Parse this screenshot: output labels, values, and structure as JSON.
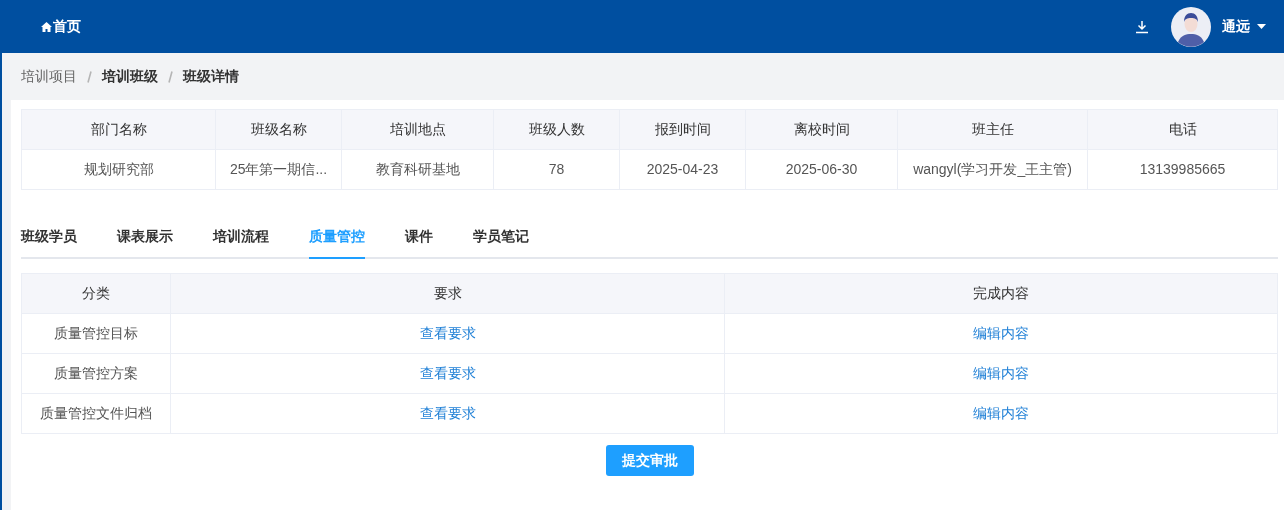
{
  "navbar": {
    "home": "首页",
    "user": "通远"
  },
  "breadcrumb": [
    "培训项目",
    "培训班级",
    "班级详情"
  ],
  "info_table": {
    "columns": [
      "部门名称",
      "班级名称",
      "培训地点",
      "班级人数",
      "报到时间",
      "离校时间",
      "班主任",
      "电话"
    ],
    "rows": [
      [
        "规划研究部",
        "25年第一期信...",
        "教育科研基地",
        "78",
        "2025-04-23",
        "2025-06-30",
        "wangyl(学习开发_王主管)",
        "13139985665"
      ]
    ]
  },
  "tabs": [
    {
      "label": "班级学员",
      "selected": false
    },
    {
      "label": "课表展示",
      "selected": false
    },
    {
      "label": "培训流程",
      "selected": false
    },
    {
      "label": "质量管控",
      "selected": true
    },
    {
      "label": "课件",
      "selected": false
    },
    {
      "label": "学员笔记",
      "selected": false
    }
  ],
  "quality_table": {
    "columns": [
      "分类",
      "要求",
      "完成内容"
    ],
    "rows": [
      {
        "category": "质量管控目标",
        "requirement": "查看要求",
        "content": "编辑内容"
      },
      {
        "category": "质量管控方案",
        "requirement": "查看要求",
        "content": "编辑内容"
      },
      {
        "category": "质量管控文件归档",
        "requirement": "查看要求",
        "content": "编辑内容"
      }
    ]
  },
  "submit_button": "提交审批"
}
